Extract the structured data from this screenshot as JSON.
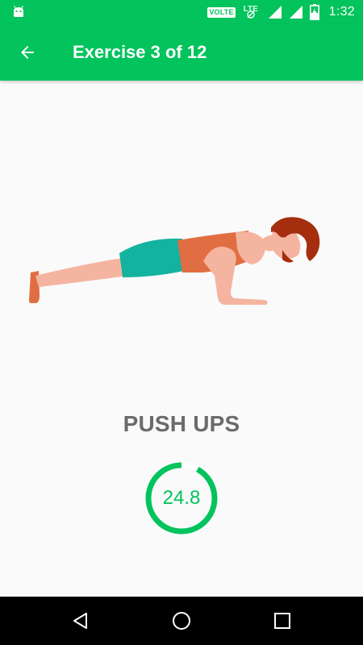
{
  "status_bar": {
    "volte": "VOLTE",
    "lte": "LTE",
    "time": "1:32",
    "icons": [
      "android-icon",
      "volte-icon",
      "lte-icon",
      "signal-icon",
      "signal-icon",
      "battery-charging-icon"
    ]
  },
  "app_bar": {
    "back_icon": "arrow-back-icon",
    "title": "Exercise 3 of 12"
  },
  "exercise": {
    "name": "PUSH UPS",
    "illustration": "person-doing-push-up"
  },
  "timer": {
    "value": "24.8",
    "progress": 0.92
  },
  "nav_bar": {
    "icons": [
      "back-triangle-icon",
      "home-circle-icon",
      "recents-square-icon"
    ]
  },
  "colors": {
    "primary": "#02c35c",
    "title_text": "#6b6b6b",
    "background": "#fafafa"
  }
}
